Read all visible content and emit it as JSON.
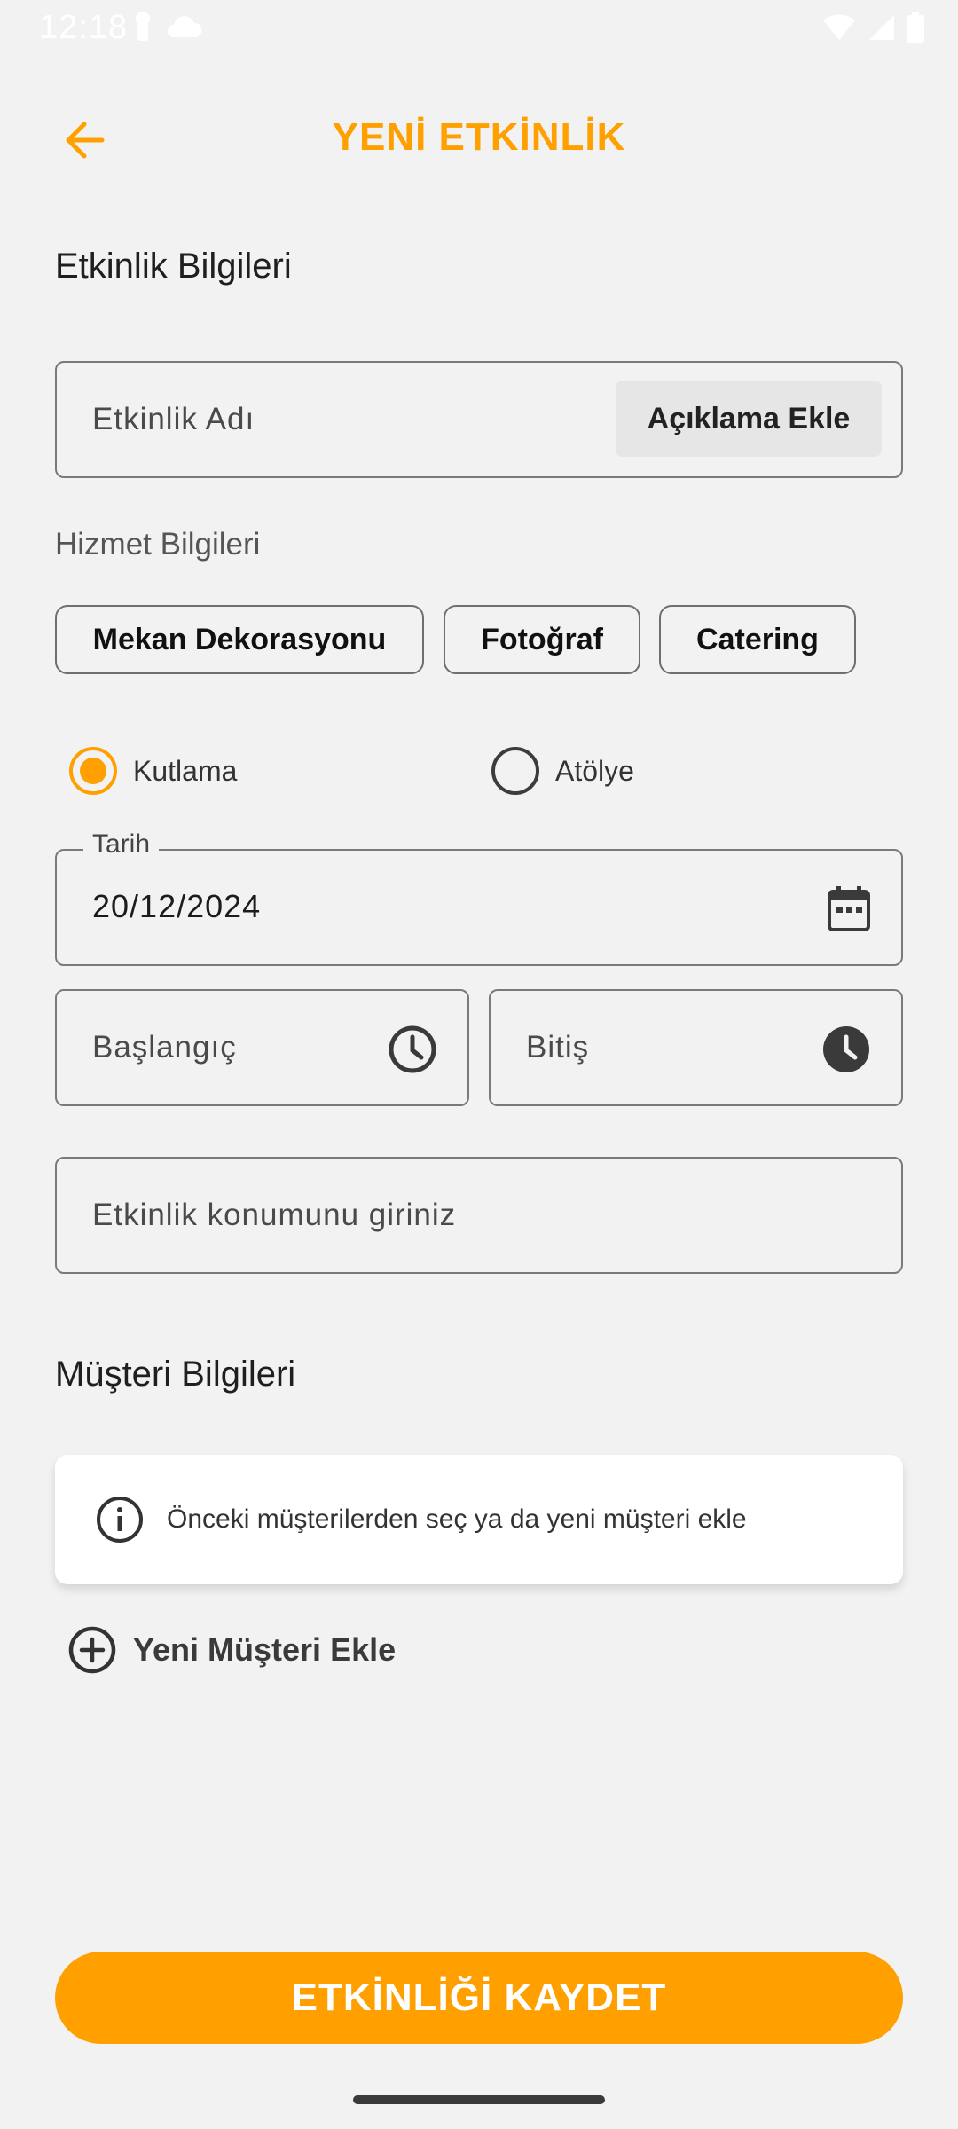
{
  "status_bar": {
    "time": "12:18"
  },
  "header": {
    "title": "YENİ ETKİNLİK"
  },
  "event_section": {
    "title": "Etkinlik Bilgileri",
    "name_placeholder": "Etkinlik Adı",
    "description_button": "Açıklama Ekle"
  },
  "service_section": {
    "title": "Hizmet Bilgileri",
    "chips": [
      "Mekan Dekorasyonu",
      "Fotoğraf",
      "Catering"
    ]
  },
  "event_type": {
    "options": [
      {
        "label": "Kutlama",
        "selected": true
      },
      {
        "label": "Atölye",
        "selected": false
      }
    ]
  },
  "date_field": {
    "label": "Tarih",
    "value": "20/12/2024"
  },
  "time_fields": {
    "start_placeholder": "Başlangıç",
    "end_placeholder": "Bitiş"
  },
  "location_field": {
    "placeholder": "Etkinlik konumunu giriniz"
  },
  "customer_section": {
    "title": "Müşteri Bilgileri",
    "info_text": "Önceki müşterilerden seç ya da yeni müşteri ekle",
    "add_button": "Yeni Müşteri Ekle"
  },
  "save_button": "ETKİNLİĞİ KAYDET",
  "colors": {
    "accent": "#ffa000",
    "background": "#f2f2f2"
  }
}
